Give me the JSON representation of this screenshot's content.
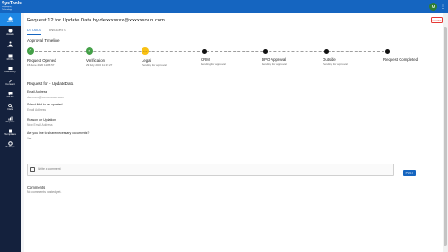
{
  "brand": {
    "name": "SysTools",
    "tagline": "Simplifying Technology"
  },
  "topbar": {
    "avatar_initial": "M"
  },
  "sidebar": {
    "items": [
      {
        "label": "Home",
        "icon": "home-icon",
        "active": true
      },
      {
        "label": "Assets",
        "icon": "assets-icon",
        "active": false
      },
      {
        "label": "Audit",
        "icon": "audit-icon",
        "active": false
      },
      {
        "label": "ROPA",
        "icon": "ropa-icon",
        "active": false
      },
      {
        "label": "Discovery",
        "icon": "discovery-icon",
        "active": false
      },
      {
        "label": "Consent",
        "icon": "consent-icon",
        "active": false
      },
      {
        "label": "DSAR",
        "icon": "dsar-icon",
        "active": false
      },
      {
        "label": "Data",
        "icon": "data-icon",
        "active": false
      },
      {
        "label": "Reports",
        "icon": "reports-icon",
        "active": false
      },
      {
        "label": "Templates",
        "icon": "templates-icon",
        "active": false
      },
      {
        "label": "Settings",
        "icon": "settings-icon",
        "active": false
      }
    ]
  },
  "header": {
    "title": "Request 12 for Update Data by dexxxxxxx@xxxxxxoup.com",
    "close_label": "CLOSE"
  },
  "tabs": [
    {
      "label": "DETAILS",
      "active": true
    },
    {
      "label": "INSIGHTS",
      "active": false
    }
  ],
  "approval": {
    "title": "Approval Timeline",
    "steps": [
      {
        "label": "Request Opened",
        "sub": "15 June 2020 11:05:57",
        "status": "done"
      },
      {
        "label": "Verification",
        "sub": "29 July 2020 11:15:27",
        "status": "done"
      },
      {
        "label": "Legal",
        "sub": "Pending for approval",
        "status": "current"
      },
      {
        "label": "CRM",
        "sub": "Pending for approval",
        "status": "pending"
      },
      {
        "label": "DPO Approval",
        "sub": "Pending for approval",
        "status": "pending"
      },
      {
        "label": "Outside",
        "sub": "Pending for approval",
        "status": "pending"
      },
      {
        "label": "Request Completed",
        "sub": "",
        "status": "pending"
      }
    ]
  },
  "request": {
    "title": "Request for - UpdateData",
    "fields": [
      {
        "label": "Email Address",
        "value": "dexxxxxx@xxxxxxxoup.com"
      },
      {
        "label": "Select field to be updated",
        "value": "Email Address"
      },
      {
        "label": "Reason for Updation",
        "value": "New Email Address"
      },
      {
        "label": "Are you fine to share necessary documents?",
        "value": "Yes"
      }
    ]
  },
  "comment": {
    "placeholder": "Write a comment",
    "post_label": "POST"
  },
  "comments": {
    "title": "Comments",
    "empty_text": "No comments posted yet."
  },
  "colors": {
    "primary": "#1565c0",
    "sidebar": "#14213d",
    "done": "#43a047",
    "current": "#f9c114",
    "close": "#e53935"
  }
}
